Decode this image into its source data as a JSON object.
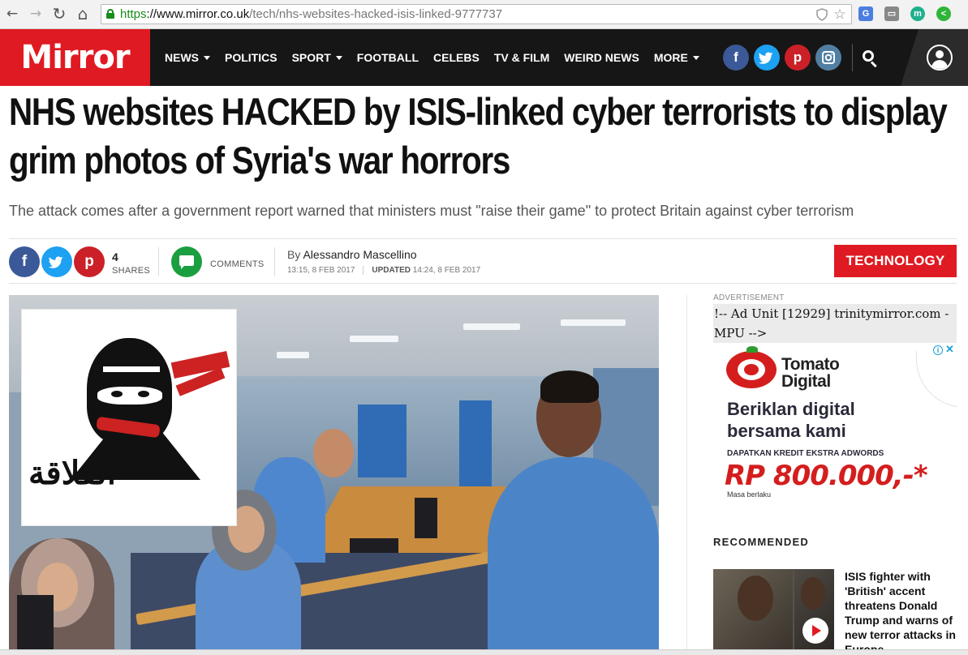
{
  "browser": {
    "url_scheme": "https",
    "url_host": "://www.mirror.co.uk",
    "url_path": "/tech/nhs-websites-hacked-isis-linked-9777737",
    "back_glyph": "←",
    "forward_glyph": "→",
    "reload_glyph": "↻",
    "home_glyph": "⌂",
    "star_glyph": "☆"
  },
  "site": {
    "logo": "Mirror",
    "nav": [
      {
        "label": "NEWS",
        "dropdown": true
      },
      {
        "label": "POLITICS",
        "dropdown": false
      },
      {
        "label": "SPORT",
        "dropdown": true
      },
      {
        "label": "FOOTBALL",
        "dropdown": false
      },
      {
        "label": "CELEBS",
        "dropdown": false
      },
      {
        "label": "TV & FILM",
        "dropdown": false
      },
      {
        "label": "WEIRD NEWS",
        "dropdown": false
      },
      {
        "label": "MORE",
        "dropdown": true
      }
    ],
    "social": {
      "facebook": "f",
      "twitter": "t",
      "pinterest": "p",
      "instagram": "◘"
    },
    "colors": {
      "brand_red": "#e01a22",
      "header_bg": "#161616",
      "facebook": "#3b5998",
      "twitter": "#1da1f2",
      "pinterest": "#cb2027",
      "instagram": "#517fa4",
      "comments_green": "#1a9f40"
    }
  },
  "article": {
    "headline": "NHS websites HACKED by ISIS-linked cyber terrorists to display grim photos of Syria's war horrors",
    "standfirst": "The attack comes after a government report warned that ministers must \"raise their game\" to protect Britain against cyber terrorism",
    "share_count": "4",
    "shares_label": "SHARES",
    "comments_label": "COMMENTS",
    "by_prefix": "By",
    "author": "Alessandro Mascellino",
    "published": "13:15, 8 FEB 2017",
    "updated_label": "UPDATED",
    "updated": "14:24, 8 FEB 2017",
    "section_tag": "TECHNOLOGY",
    "hero_logo_script": "الفلاقة"
  },
  "sidebar": {
    "ad_label": "ADVERTISEMENT",
    "ad_code_text": "!-- Ad Unit [12929] trinitymirror.com - MPU -->",
    "ad_brand_line1": "Tomato",
    "ad_brand_line2": "Digital",
    "ad_headline_1": "Beriklan digital",
    "ad_headline_2": "bersama kami",
    "ad_subline": "DAPATKAN KREDIT EKSTRA ADWORDS",
    "ad_price": "RP 800.000,-*",
    "ad_small": "Masa berlaku",
    "ad_info": "i",
    "ad_close": "✕",
    "recommended_title": "RECOMMENDED",
    "recommended_item": "ISIS fighter with 'British' accent threatens Donald Trump and warns of new terror attacks in Europe"
  }
}
